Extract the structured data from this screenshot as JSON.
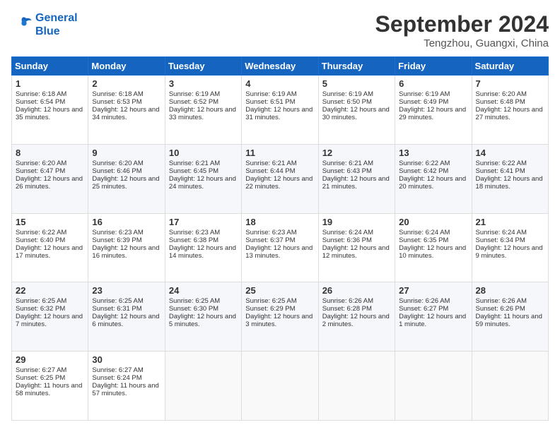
{
  "logo": {
    "line1": "General",
    "line2": "Blue"
  },
  "title": "September 2024",
  "location": "Tengzhou, Guangxi, China",
  "weekdays": [
    "Sunday",
    "Monday",
    "Tuesday",
    "Wednesday",
    "Thursday",
    "Friday",
    "Saturday"
  ],
  "weeks": [
    [
      {
        "day": "1",
        "sunrise": "Sunrise: 6:18 AM",
        "sunset": "Sunset: 6:54 PM",
        "daylight": "Daylight: 12 hours and 35 minutes."
      },
      {
        "day": "2",
        "sunrise": "Sunrise: 6:18 AM",
        "sunset": "Sunset: 6:53 PM",
        "daylight": "Daylight: 12 hours and 34 minutes."
      },
      {
        "day": "3",
        "sunrise": "Sunrise: 6:19 AM",
        "sunset": "Sunset: 6:52 PM",
        "daylight": "Daylight: 12 hours and 33 minutes."
      },
      {
        "day": "4",
        "sunrise": "Sunrise: 6:19 AM",
        "sunset": "Sunset: 6:51 PM",
        "daylight": "Daylight: 12 hours and 31 minutes."
      },
      {
        "day": "5",
        "sunrise": "Sunrise: 6:19 AM",
        "sunset": "Sunset: 6:50 PM",
        "daylight": "Daylight: 12 hours and 30 minutes."
      },
      {
        "day": "6",
        "sunrise": "Sunrise: 6:19 AM",
        "sunset": "Sunset: 6:49 PM",
        "daylight": "Daylight: 12 hours and 29 minutes."
      },
      {
        "day": "7",
        "sunrise": "Sunrise: 6:20 AM",
        "sunset": "Sunset: 6:48 PM",
        "daylight": "Daylight: 12 hours and 27 minutes."
      }
    ],
    [
      {
        "day": "8",
        "sunrise": "Sunrise: 6:20 AM",
        "sunset": "Sunset: 6:47 PM",
        "daylight": "Daylight: 12 hours and 26 minutes."
      },
      {
        "day": "9",
        "sunrise": "Sunrise: 6:20 AM",
        "sunset": "Sunset: 6:46 PM",
        "daylight": "Daylight: 12 hours and 25 minutes."
      },
      {
        "day": "10",
        "sunrise": "Sunrise: 6:21 AM",
        "sunset": "Sunset: 6:45 PM",
        "daylight": "Daylight: 12 hours and 24 minutes."
      },
      {
        "day": "11",
        "sunrise": "Sunrise: 6:21 AM",
        "sunset": "Sunset: 6:44 PM",
        "daylight": "Daylight: 12 hours and 22 minutes."
      },
      {
        "day": "12",
        "sunrise": "Sunrise: 6:21 AM",
        "sunset": "Sunset: 6:43 PM",
        "daylight": "Daylight: 12 hours and 21 minutes."
      },
      {
        "day": "13",
        "sunrise": "Sunrise: 6:22 AM",
        "sunset": "Sunset: 6:42 PM",
        "daylight": "Daylight: 12 hours and 20 minutes."
      },
      {
        "day": "14",
        "sunrise": "Sunrise: 6:22 AM",
        "sunset": "Sunset: 6:41 PM",
        "daylight": "Daylight: 12 hours and 18 minutes."
      }
    ],
    [
      {
        "day": "15",
        "sunrise": "Sunrise: 6:22 AM",
        "sunset": "Sunset: 6:40 PM",
        "daylight": "Daylight: 12 hours and 17 minutes."
      },
      {
        "day": "16",
        "sunrise": "Sunrise: 6:23 AM",
        "sunset": "Sunset: 6:39 PM",
        "daylight": "Daylight: 12 hours and 16 minutes."
      },
      {
        "day": "17",
        "sunrise": "Sunrise: 6:23 AM",
        "sunset": "Sunset: 6:38 PM",
        "daylight": "Daylight: 12 hours and 14 minutes."
      },
      {
        "day": "18",
        "sunrise": "Sunrise: 6:23 AM",
        "sunset": "Sunset: 6:37 PM",
        "daylight": "Daylight: 12 hours and 13 minutes."
      },
      {
        "day": "19",
        "sunrise": "Sunrise: 6:24 AM",
        "sunset": "Sunset: 6:36 PM",
        "daylight": "Daylight: 12 hours and 12 minutes."
      },
      {
        "day": "20",
        "sunrise": "Sunrise: 6:24 AM",
        "sunset": "Sunset: 6:35 PM",
        "daylight": "Daylight: 12 hours and 10 minutes."
      },
      {
        "day": "21",
        "sunrise": "Sunrise: 6:24 AM",
        "sunset": "Sunset: 6:34 PM",
        "daylight": "Daylight: 12 hours and 9 minutes."
      }
    ],
    [
      {
        "day": "22",
        "sunrise": "Sunrise: 6:25 AM",
        "sunset": "Sunset: 6:32 PM",
        "daylight": "Daylight: 12 hours and 7 minutes."
      },
      {
        "day": "23",
        "sunrise": "Sunrise: 6:25 AM",
        "sunset": "Sunset: 6:31 PM",
        "daylight": "Daylight: 12 hours and 6 minutes."
      },
      {
        "day": "24",
        "sunrise": "Sunrise: 6:25 AM",
        "sunset": "Sunset: 6:30 PM",
        "daylight": "Daylight: 12 hours and 5 minutes."
      },
      {
        "day": "25",
        "sunrise": "Sunrise: 6:25 AM",
        "sunset": "Sunset: 6:29 PM",
        "daylight": "Daylight: 12 hours and 3 minutes."
      },
      {
        "day": "26",
        "sunrise": "Sunrise: 6:26 AM",
        "sunset": "Sunset: 6:28 PM",
        "daylight": "Daylight: 12 hours and 2 minutes."
      },
      {
        "day": "27",
        "sunrise": "Sunrise: 6:26 AM",
        "sunset": "Sunset: 6:27 PM",
        "daylight": "Daylight: 12 hours and 1 minute."
      },
      {
        "day": "28",
        "sunrise": "Sunrise: 6:26 AM",
        "sunset": "Sunset: 6:26 PM",
        "daylight": "Daylight: 11 hours and 59 minutes."
      }
    ],
    [
      {
        "day": "29",
        "sunrise": "Sunrise: 6:27 AM",
        "sunset": "Sunset: 6:25 PM",
        "daylight": "Daylight: 11 hours and 58 minutes."
      },
      {
        "day": "30",
        "sunrise": "Sunrise: 6:27 AM",
        "sunset": "Sunset: 6:24 PM",
        "daylight": "Daylight: 11 hours and 57 minutes."
      },
      null,
      null,
      null,
      null,
      null
    ]
  ]
}
